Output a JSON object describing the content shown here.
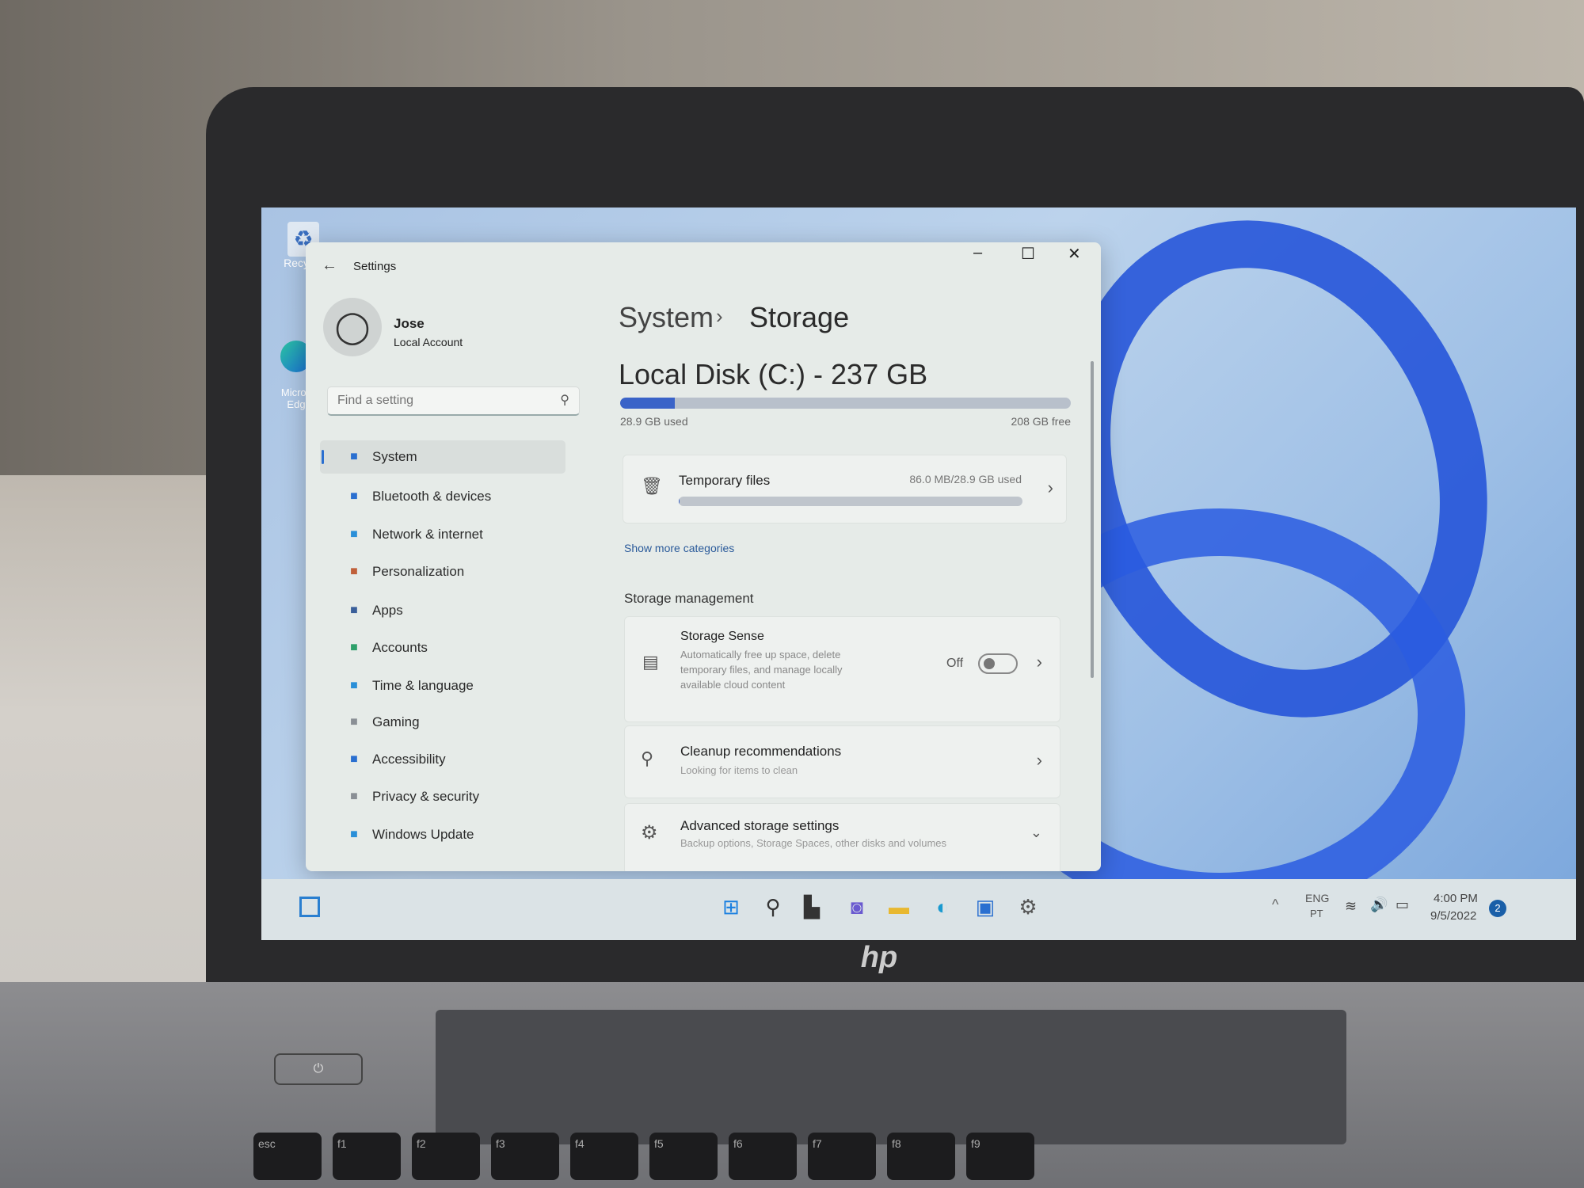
{
  "desktop": {
    "icons": [
      {
        "label": "Recycle",
        "icon": "recycle-bin-icon"
      },
      {
        "label": "Micros\nEdg",
        "icon": "edge-icon"
      }
    ]
  },
  "window": {
    "title": "Settings",
    "controls": {
      "minimize": "–",
      "maximize": "☐",
      "close": "✕"
    },
    "user": {
      "name": "Jose",
      "account": "Local Account"
    },
    "search": {
      "placeholder": "Find a setting"
    },
    "nav": [
      {
        "label": "System",
        "icon": "system-icon",
        "color": "#2a6fd0",
        "selected": true
      },
      {
        "label": "Bluetooth & devices",
        "icon": "bluetooth-icon",
        "color": "#2a6fd0"
      },
      {
        "label": "Network & internet",
        "icon": "wifi-icon",
        "color": "#2a8fd8"
      },
      {
        "label": "Personalization",
        "icon": "brush-icon",
        "color": "#c0603a"
      },
      {
        "label": "Apps",
        "icon": "apps-icon",
        "color": "#3a5f9a"
      },
      {
        "label": "Accounts",
        "icon": "accounts-icon",
        "color": "#2ea06a"
      },
      {
        "label": "Time & language",
        "icon": "globe-clock-icon",
        "color": "#2a8fd8"
      },
      {
        "label": "Gaming",
        "icon": "gamepad-icon",
        "color": "#8a8f95"
      },
      {
        "label": "Accessibility",
        "icon": "accessibility-icon",
        "color": "#2a6fd0"
      },
      {
        "label": "Privacy & security",
        "icon": "shield-icon",
        "color": "#8a8f95"
      },
      {
        "label": "Windows Update",
        "icon": "update-icon",
        "color": "#2a8fd8"
      }
    ],
    "breadcrumb": {
      "parent": "System",
      "separator": "›",
      "current": "Storage"
    },
    "disk": {
      "title": "Local Disk (C:) - 237 GB",
      "used_label": "28.9 GB used",
      "free_label": "208 GB free",
      "used_fraction": 0.122,
      "bar_color": "#3a63c8"
    },
    "temp_files": {
      "label": "Temporary files",
      "usage": "86.0 MB/28.9 GB used",
      "fraction": 0.003
    },
    "show_more": "Show more categories",
    "section_title": "Storage management",
    "storage_sense": {
      "title": "Storage Sense",
      "description": "Automatically free up space, delete temporary files, and manage locally available cloud content",
      "state_label": "Off",
      "on": false
    },
    "cleanup": {
      "title": "Cleanup recommendations",
      "subtitle": "Looking for items to clean"
    },
    "advanced": {
      "title": "Advanced storage settings",
      "subtitle": "Backup options, Storage Spaces, other disks and volumes"
    }
  },
  "taskbar": {
    "apps": [
      "start-icon",
      "search-icon",
      "task-view-icon",
      "chat-icon",
      "file-explorer-icon",
      "edge-icon",
      "store-icon",
      "settings-icon"
    ],
    "tray": {
      "language": "ENG",
      "layout": "PT",
      "time": "4:00 PM",
      "date": "9/5/2022",
      "notifications": "2"
    }
  },
  "laptop": {
    "brand": "hp",
    "keys": [
      "esc",
      "f1",
      "f2",
      "f3",
      "f4",
      "f5",
      "f6",
      "f7",
      "f8",
      "f9"
    ]
  }
}
